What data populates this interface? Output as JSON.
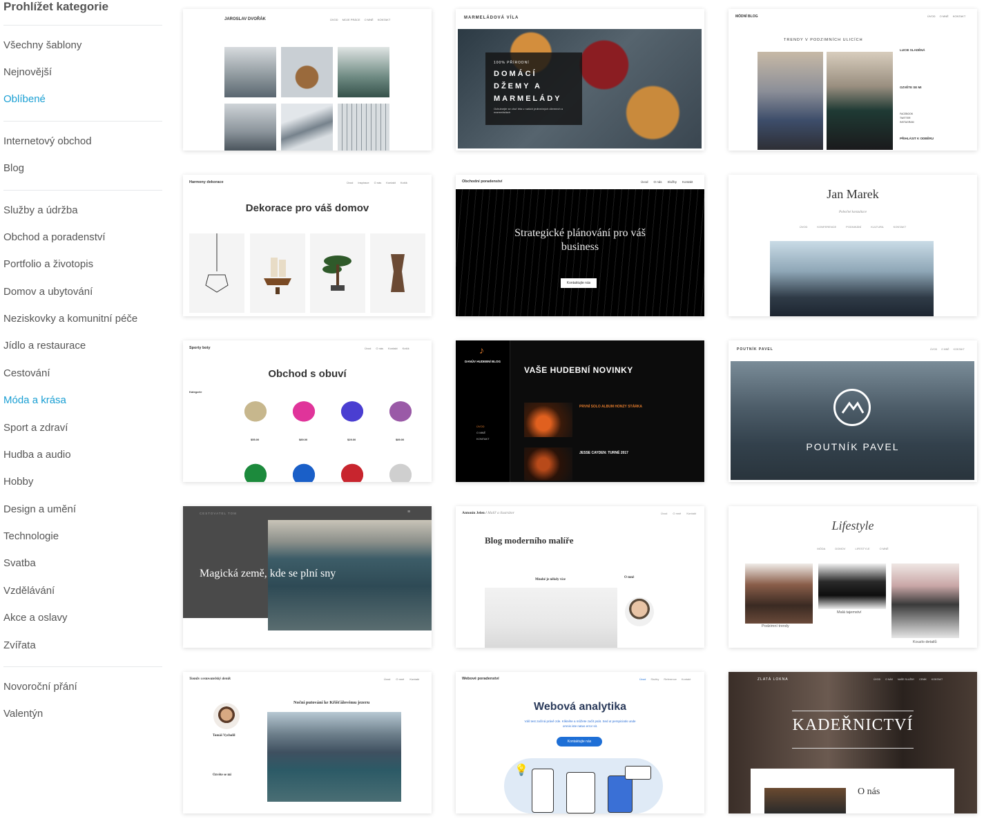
{
  "sidebar": {
    "title": "Prohlížet kategorie",
    "groups": [
      [
        "Všechny šablony",
        "Nejnovější",
        "Oblíbené"
      ],
      [
        "Internetový obchod",
        "Blog"
      ],
      [
        "Služby a údržba",
        "Obchod a poradenství",
        "Portfolio a životopis",
        "Domov a ubytování",
        "Neziskovky a komunitní péče",
        "Jídlo a restaurace",
        "Cestování",
        "Móda a krása",
        "Sport a zdraví",
        "Hudba a audio",
        "Hobby",
        "Design a umění",
        "Technologie",
        "Svatba",
        "Vzdělávání",
        "Akce a oslavy",
        "Zvířata"
      ],
      [
        "Novoroční přání",
        "Valentýn"
      ]
    ],
    "active": [
      "Oblíbené",
      "Móda a krása"
    ]
  },
  "colors": {
    "accent": "#1a9fd3",
    "text": "#555555"
  },
  "cards": {
    "c1": {
      "brand": "JAROSLAV DVOŘÁK",
      "nav": [
        "ÚVOD",
        "MOJE PRÁCE",
        "O MNĚ",
        "KONTAKT"
      ]
    },
    "c2": {
      "brand": "MARMELÁDOVÁ VÍLA",
      "tag": "100% PŘÍRODNÍ",
      "headline": "DOMÁCÍ DŽEMY A MARMELÁDY",
      "sub": "Ochutnejte se chuť léta v našich jedinečných džemech a marmeládách"
    },
    "c3": {
      "brand": "MÓDNÍ BLOG",
      "nav": [
        "ÚVOD",
        "O MNĚ",
        "KONTAKT"
      ],
      "headline": "TRENDY V PODZIMNÍCH ULICÍCH",
      "author": "LUCIE SLADĚNÁ",
      "follow": "OZVĚTE SE MI",
      "links": [
        "FACEBOOK",
        "TWITTER",
        "INSTAGRAM"
      ],
      "subscribe": "PŘIHLÁSIT K ODBĚRU"
    },
    "c4": {
      "brand": "Harmony dekorace",
      "nav": [
        "Úvod",
        "Inspirace",
        "O nás",
        "Kontakt",
        "Košík"
      ],
      "headline": "Dekorace pro váš domov"
    },
    "c5": {
      "brand": "Obchodní poradenství",
      "nav": [
        "Úvod",
        "O nás",
        "Služby",
        "Kontakt"
      ],
      "headline": "Strategické plánování pro váš business",
      "button": "Kontaktujte nás"
    },
    "c6": {
      "brand": "Jan Marek",
      "subtitle": "Pobočné konzultace",
      "nav": [
        "ÚVOD",
        "KONFERENCE",
        "PODNIKÁNÍ",
        "KULTURA",
        "KONTAKT"
      ]
    },
    "c7": {
      "brand": "Sporty boty",
      "nav": [
        "Úvod",
        "O nás",
        "Kontakt",
        "Košík"
      ],
      "headline": "Obchod s obuví",
      "side": "Kategorie",
      "prices": [
        "$55.00",
        "$89.00",
        "$29.00",
        "$89.00"
      ]
    },
    "c8": {
      "brand": "DANŮV HUDEBNÍ BLOG",
      "nav": [
        "ÚVOD",
        "O MNĚ",
        "KONTAKT"
      ],
      "headline": "VAŠE HUDEBNÍ NOVINKY",
      "post1": "PRVNÍ SOLO ALBUM HONZY STÁRKA",
      "post2": "JESSE CAYDEN: TURNÉ 2017"
    },
    "c9": {
      "brand": "POUTNÍK PAVEL",
      "nav": [
        "ÚVOD",
        "O MNĚ",
        "KONTAKT"
      ],
      "headline": "POUTNÍK PAVEL"
    },
    "c10": {
      "brand": "CESTOVATEL TOM",
      "headline": "Magická země, kde se plní sny"
    },
    "c11": {
      "brand": "Antonín Jelen",
      "tagline": "Malíř a ilustrátor",
      "nav": [
        "Úvod",
        "O mně",
        "Kontakt"
      ],
      "headline": "Blog moderního malíře",
      "post": "Mnohé je někdy více",
      "about": "O mně"
    },
    "c12": {
      "brand": "Lifestyle",
      "nav": [
        "MÓDA",
        "DOMOV",
        "LIFESTYLE",
        "O MNĚ"
      ],
      "captions": [
        "Podzimní trendy",
        "Malá tajemství",
        "Kouzlo detailů"
      ]
    },
    "c13": {
      "brand": "Tomův cestovatelský deník",
      "nav": [
        "Úvod",
        "O mně",
        "Kontakt"
      ],
      "headline": "Noční putování ke Křišťálovému jezeru",
      "author": "Tomáš Vycholil",
      "follow": "Ozvěte se mi"
    },
    "c14": {
      "brand": "Webové poradenství",
      "nav": [
        "Úvod",
        "Služby",
        "Reference",
        "Kontakt"
      ],
      "headline": "Webová analytika",
      "sub": "Váš test začíná právě zde. Klikněte a můžete začít psát. Sed ut perspiciatis unde omnis iste natus error sit.",
      "button": "Kontaktujte nás"
    },
    "c15": {
      "brand": "ZLATÁ LOKNA",
      "nav": [
        "ÚVOD",
        "O NÁS",
        "NAŠE SLUŽBY",
        "CENÍK",
        "KONTAKT"
      ],
      "headline": "KADEŘNICTVÍ",
      "section": "O nás"
    }
  }
}
